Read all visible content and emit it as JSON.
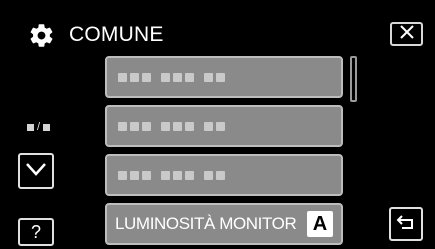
{
  "header": {
    "title": "COMUNE",
    "icon": "gear-icon"
  },
  "controls": {
    "close_icon": "close-icon",
    "down_icon": "chevron-down-icon",
    "help_label": "?",
    "back_icon": "return-icon"
  },
  "menu": {
    "items": [
      {
        "label": ""
      },
      {
        "label": ""
      },
      {
        "label": ""
      },
      {
        "label": "LUMINOSITÀ MONITOR",
        "badge": "A"
      }
    ]
  },
  "page_indicator": {
    "separator": "/"
  },
  "colors": {
    "background": "#000000",
    "item_fill": "#8a8a8a",
    "item_border": "#bdbdbd"
  }
}
